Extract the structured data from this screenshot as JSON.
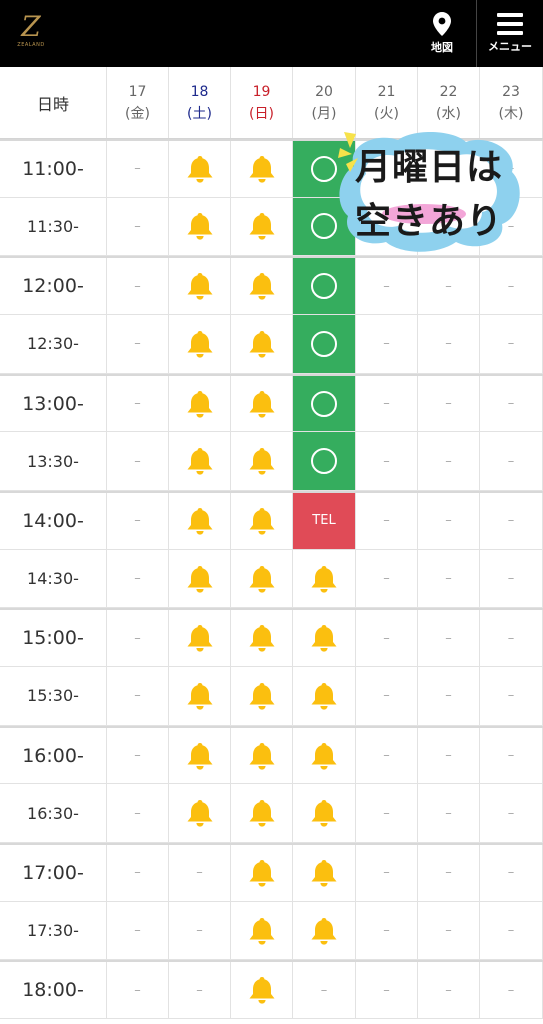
{
  "header": {
    "logo_text": "ZEALAND",
    "map_label": "地図",
    "menu_label": "メニュー"
  },
  "table": {
    "corner_label": "日時",
    "days": [
      {
        "date": "17",
        "weekday": "(金)",
        "kind": "weekday"
      },
      {
        "date": "18",
        "weekday": "(土)",
        "kind": "sat"
      },
      {
        "date": "19",
        "weekday": "(日)",
        "kind": "sun"
      },
      {
        "date": "20",
        "weekday": "(月)",
        "kind": "weekday"
      },
      {
        "date": "21",
        "weekday": "(火)",
        "kind": "weekday"
      },
      {
        "date": "22",
        "weekday": "(水)",
        "kind": "weekday"
      },
      {
        "date": "23",
        "weekday": "(木)",
        "kind": "weekday"
      }
    ],
    "rows": [
      {
        "time": "11:00-",
        "slots": [
          "dash",
          "bell",
          "bell",
          "open",
          "dash",
          "dash",
          "dash"
        ]
      },
      {
        "time": "11:30-",
        "slots": [
          "dash",
          "bell",
          "bell",
          "open",
          "dash",
          "dash",
          "dash"
        ]
      },
      {
        "time": "12:00-",
        "slots": [
          "dash",
          "bell",
          "bell",
          "open",
          "dash",
          "dash",
          "dash"
        ]
      },
      {
        "time": "12:30-",
        "slots": [
          "dash",
          "bell",
          "bell",
          "open",
          "dash",
          "dash",
          "dash"
        ]
      },
      {
        "time": "13:00-",
        "slots": [
          "dash",
          "bell",
          "bell",
          "open",
          "dash",
          "dash",
          "dash"
        ]
      },
      {
        "time": "13:30-",
        "slots": [
          "dash",
          "bell",
          "bell",
          "open",
          "dash",
          "dash",
          "dash"
        ]
      },
      {
        "time": "14:00-",
        "slots": [
          "dash",
          "bell",
          "bell",
          "tel",
          "dash",
          "dash",
          "dash"
        ]
      },
      {
        "time": "14:30-",
        "slots": [
          "dash",
          "bell",
          "bell",
          "bell",
          "dash",
          "dash",
          "dash"
        ]
      },
      {
        "time": "15:00-",
        "slots": [
          "dash",
          "bell",
          "bell",
          "bell",
          "dash",
          "dash",
          "dash"
        ]
      },
      {
        "time": "15:30-",
        "slots": [
          "dash",
          "bell",
          "bell",
          "bell",
          "dash",
          "dash",
          "dash"
        ]
      },
      {
        "time": "16:00-",
        "slots": [
          "dash",
          "bell",
          "bell",
          "bell",
          "dash",
          "dash",
          "dash"
        ]
      },
      {
        "time": "16:30-",
        "slots": [
          "dash",
          "bell",
          "bell",
          "bell",
          "dash",
          "dash",
          "dash"
        ]
      },
      {
        "time": "17:00-",
        "slots": [
          "dash",
          "dash",
          "bell",
          "bell",
          "dash",
          "dash",
          "dash"
        ]
      },
      {
        "time": "17:30-",
        "slots": [
          "dash",
          "dash",
          "bell",
          "bell",
          "dash",
          "dash",
          "dash"
        ]
      },
      {
        "time": "18:00-",
        "slots": [
          "dash",
          "dash",
          "bell",
          "dash",
          "dash",
          "dash",
          "dash"
        ]
      }
    ],
    "dash_text": "–",
    "tel_text": "TEL"
  },
  "badge": {
    "line1": "月曜日は",
    "line2": "空きあり"
  },
  "colors": {
    "header_bg": "#000000",
    "open_green": "#35ad5e",
    "tel_red": "#e04b57",
    "bell_yellow": "#fbbf0f",
    "saturday": "#1e2a8c",
    "sunday": "#c8202a",
    "logo_gold": "#b8944f"
  }
}
